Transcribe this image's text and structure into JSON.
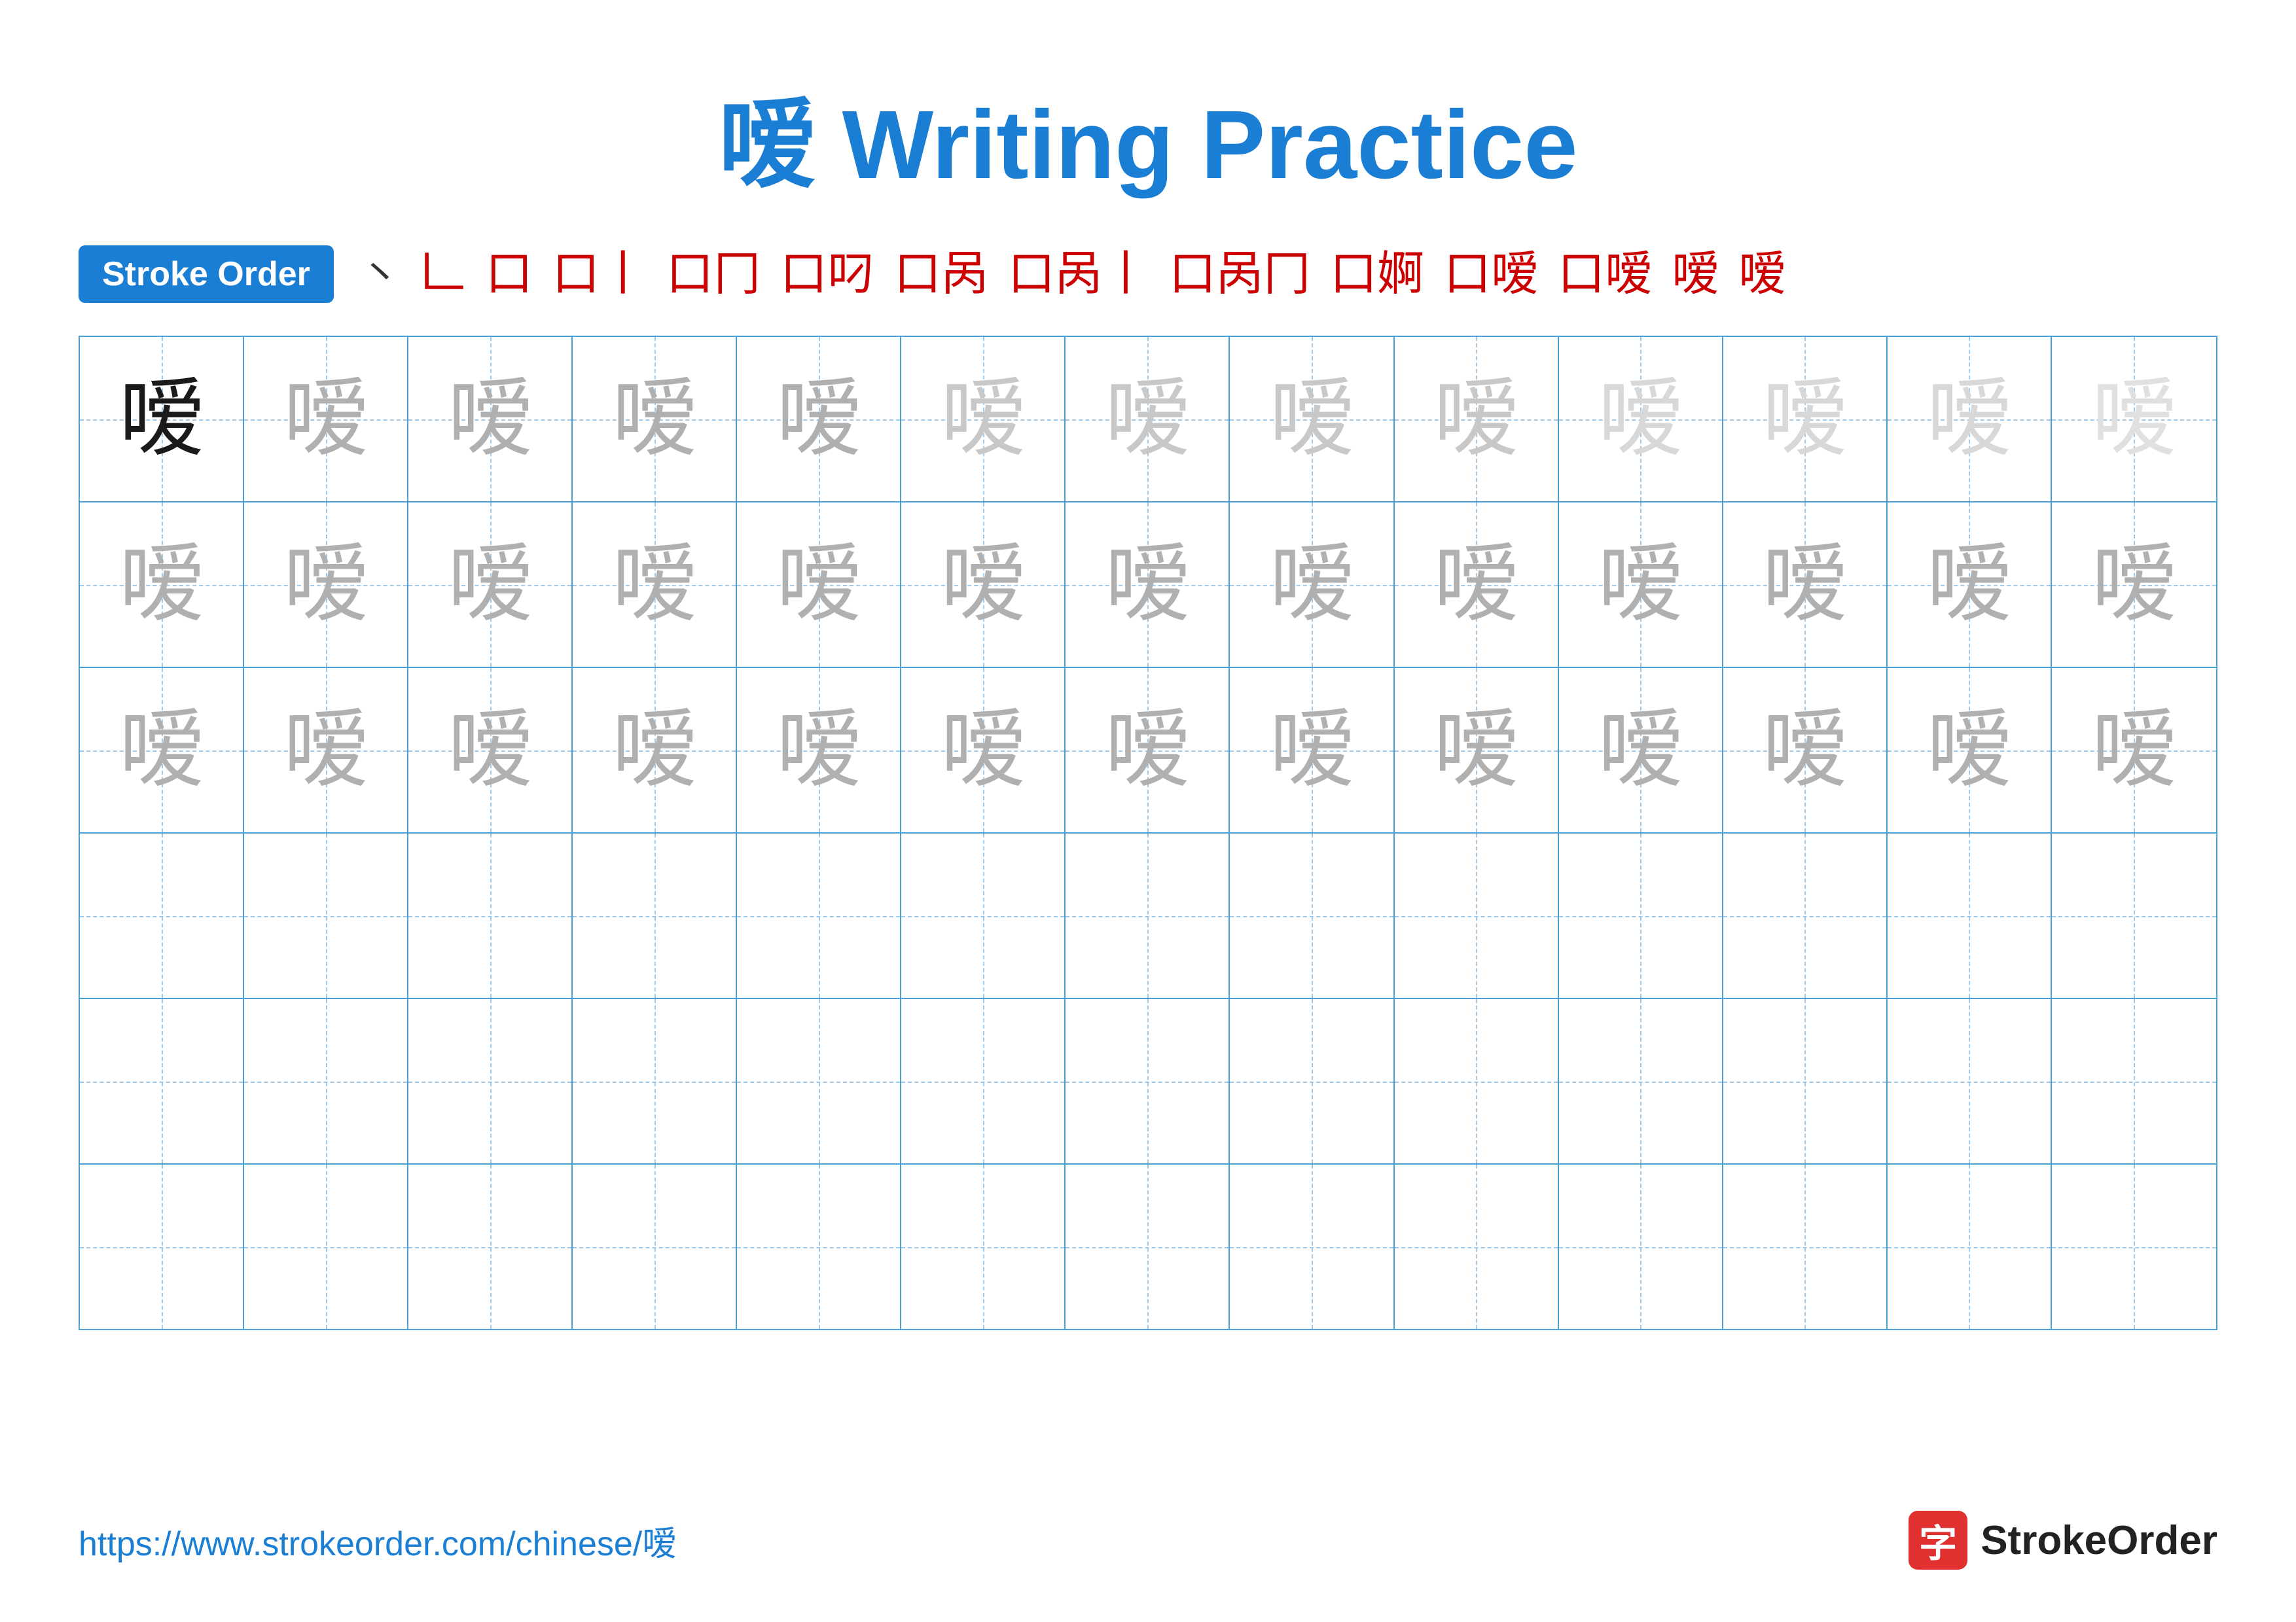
{
  "title": {
    "char": "嗳",
    "label": "Writing Practice"
  },
  "stroke_order": {
    "badge_label": "Stroke Order",
    "steps": [
      "㇔",
      "𠃊",
      "口",
      "口丨",
      "口冂",
      "口叼",
      "口呙",
      "口呙丨",
      "口呙冂",
      "口婀",
      "口嗳",
      "口嗳",
      "嗳",
      "嗳"
    ]
  },
  "grid": {
    "rows": 6,
    "cols": 13,
    "char": "嗳",
    "row_configs": [
      {
        "shades": [
          "dark",
          "light1",
          "light1",
          "light1",
          "light1",
          "light2",
          "light2",
          "light2",
          "light2",
          "light3",
          "light3",
          "light3",
          "light4"
        ]
      },
      {
        "shades": [
          "light1",
          "light1",
          "light1",
          "light1",
          "light1",
          "light1",
          "light1",
          "light1",
          "light1",
          "light1",
          "light1",
          "light1",
          "light1"
        ]
      },
      {
        "shades": [
          "light1",
          "light1",
          "light1",
          "light1",
          "light1",
          "light1",
          "light1",
          "light1",
          "light1",
          "light1",
          "light1",
          "light1",
          "light1"
        ]
      },
      {
        "shades": [
          "",
          "",
          "",
          "",
          "",
          "",
          "",
          "",
          "",
          "",
          "",
          "",
          ""
        ]
      },
      {
        "shades": [
          "",
          "",
          "",
          "",
          "",
          "",
          "",
          "",
          "",
          "",
          "",
          "",
          ""
        ]
      },
      {
        "shades": [
          "",
          "",
          "",
          "",
          "",
          "",
          "",
          "",
          "",
          "",
          "",
          "",
          ""
        ]
      }
    ]
  },
  "footer": {
    "url": "https://www.strokeorder.com/chinese/嗳",
    "logo_char": "字",
    "logo_text": "StrokeOrder"
  }
}
